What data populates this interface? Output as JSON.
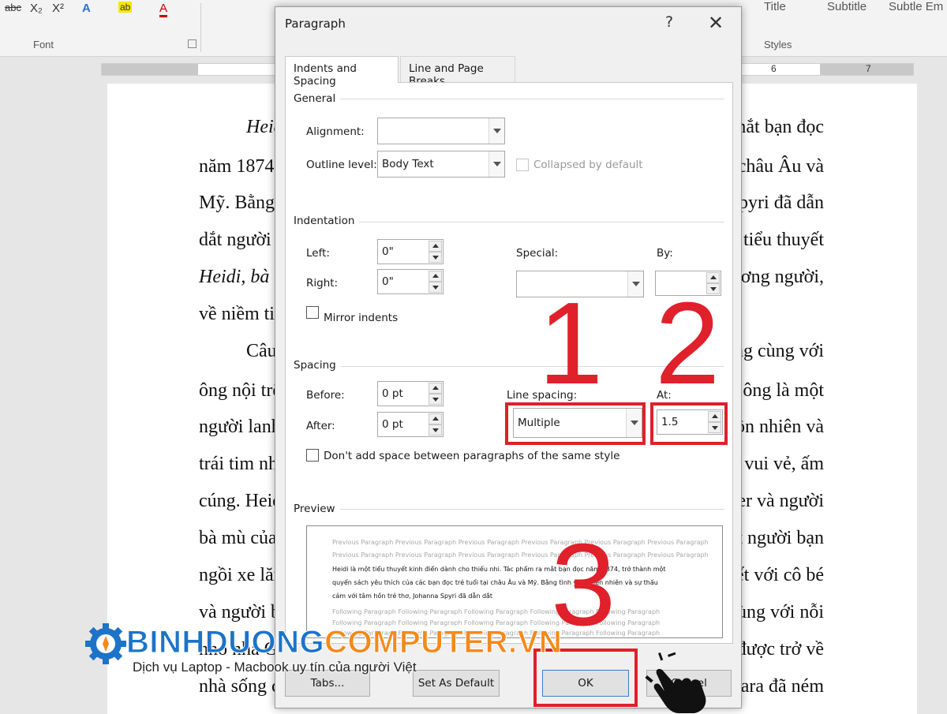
{
  "ribbon": {
    "format_buttons": [
      "abc",
      "X₂",
      "X²",
      "A",
      "ab",
      "A"
    ],
    "font_group_label": "Font",
    "styles": [
      "Title",
      "Subtitle",
      "Subtle Em"
    ],
    "styles_group_label": "Styles"
  },
  "ruler": {
    "numbers": [
      "6",
      "7"
    ]
  },
  "document": {
    "left_fragments": [
      {
        "text": "Heid",
        "italic": true
      },
      {
        "text": "năm 1874,",
        "italic": false
      },
      {
        "text": "Mỹ. Bằng",
        "italic": false
      },
      {
        "text": "dắt người c",
        "italic": false
      },
      {
        "text": "Heidi, bà đ",
        "italic": true
      },
      {
        "text": "về niềm tin",
        "italic": false
      },
      {
        "text": "Câu",
        "italic": false
      },
      {
        "text": "ông nội trê",
        "italic": false
      },
      {
        "text": "người lanh",
        "italic": false
      },
      {
        "text": "trái tim nh",
        "italic": false
      },
      {
        "text": "cúng. Heid",
        "italic": false
      },
      {
        "text": "bà mù của",
        "italic": false
      },
      {
        "text": "ngồi xe lăn",
        "italic": false
      },
      {
        "text": "và người b",
        "italic": false
      },
      {
        "text": "nhỏ nhà G",
        "italic": false
      },
      {
        "text": "nhà sống c",
        "italic": false
      }
    ],
    "right_fragments": [
      "mắt bạn đọc",
      "châu Âu và",
      "Spyri đã dẫn",
      "n tiểu thuyết",
      "hương người,",
      "",
      "ng cùng với",
      "ông là một",
      "ồn nhiên và",
      "vui vẻ, ấm",
      "ter và người",
      "t người bạn",
      "ết với cô bé",
      "ùng với nỗi",
      "được trở về",
      "lara đã ném"
    ]
  },
  "dialog": {
    "title": "Paragraph",
    "help": "?",
    "close": "✕",
    "tabs": [
      "Indents and Spacing",
      "Line and Page Breaks"
    ],
    "general": {
      "heading": "General",
      "alignment_label": "Alignment:",
      "alignment_value": "",
      "outline_label": "Outline level:",
      "outline_value": "Body Text",
      "collapsed_label": "Collapsed by default"
    },
    "indentation": {
      "heading": "Indentation",
      "left_label": "Left:",
      "left_value": "0\"",
      "right_label": "Right:",
      "right_value": "0\"",
      "special_label": "Special:",
      "special_value": "",
      "by_label": "By:",
      "by_value": "",
      "mirror_label": "Mirror indents"
    },
    "spacing": {
      "heading": "Spacing",
      "before_label": "Before:",
      "before_value": "0 pt",
      "after_label": "After:",
      "after_value": "0 pt",
      "line_spacing_label": "Line spacing:",
      "line_spacing_value": "Multiple",
      "at_label": "At:",
      "at_value": "1.5",
      "dont_add_label": "Don't add space between paragraphs of the same style"
    },
    "preview": {
      "heading": "Preview",
      "prev_line1": "Previous Paragraph Previous Paragraph Previous Paragraph Previous Paragraph Previous Paragraph Previous Paragraph",
      "prev_line2": "Previous Paragraph Previous Paragraph Previous Paragraph Previous Paragraph Previous Paragraph Previous Paragraph",
      "body_line1": "Heidi là một tiểu thuyết kinh điển dành cho thiếu nhi. Tác phẩm ra mắt bạn đọc năm 1874, trở thành một",
      "body_line2": "quyển sách yêu thích của các bạn đọc trẻ tuổi tại châu Âu và Mỹ. Bằng tình yêu thiên nhiên và sự thấu",
      "body_line3": "cảm với tâm hồn trẻ thơ, Johanna Spyri đã dẫn dắt",
      "follow_line1": "Following Paragraph Following Paragraph Following Paragraph Following Paragraph Following Paragraph",
      "follow_line2": "Following Paragraph Following Paragraph Following Paragraph Following Paragraph Following Paragraph",
      "follow_line3": "Following Paragraph Following Paragraph Following Paragraph Following Paragraph Following Paragraph"
    },
    "buttons": {
      "tabs": "Tabs...",
      "set_default": "Set As Default",
      "ok": "OK",
      "cancel": "Cancel"
    }
  },
  "annotations": {
    "step1": "1",
    "step2": "2",
    "step3": "3",
    "highlight_color": "#e0202a"
  },
  "watermark": {
    "title_part1": "BINHDUONG",
    "title_part2": "COMPUTER.VN",
    "subtitle": "Dịch vụ Laptop - Macbook uy tín của người Việt",
    "color_blue": "#1d73c9",
    "color_orange": "#f28a1c"
  }
}
